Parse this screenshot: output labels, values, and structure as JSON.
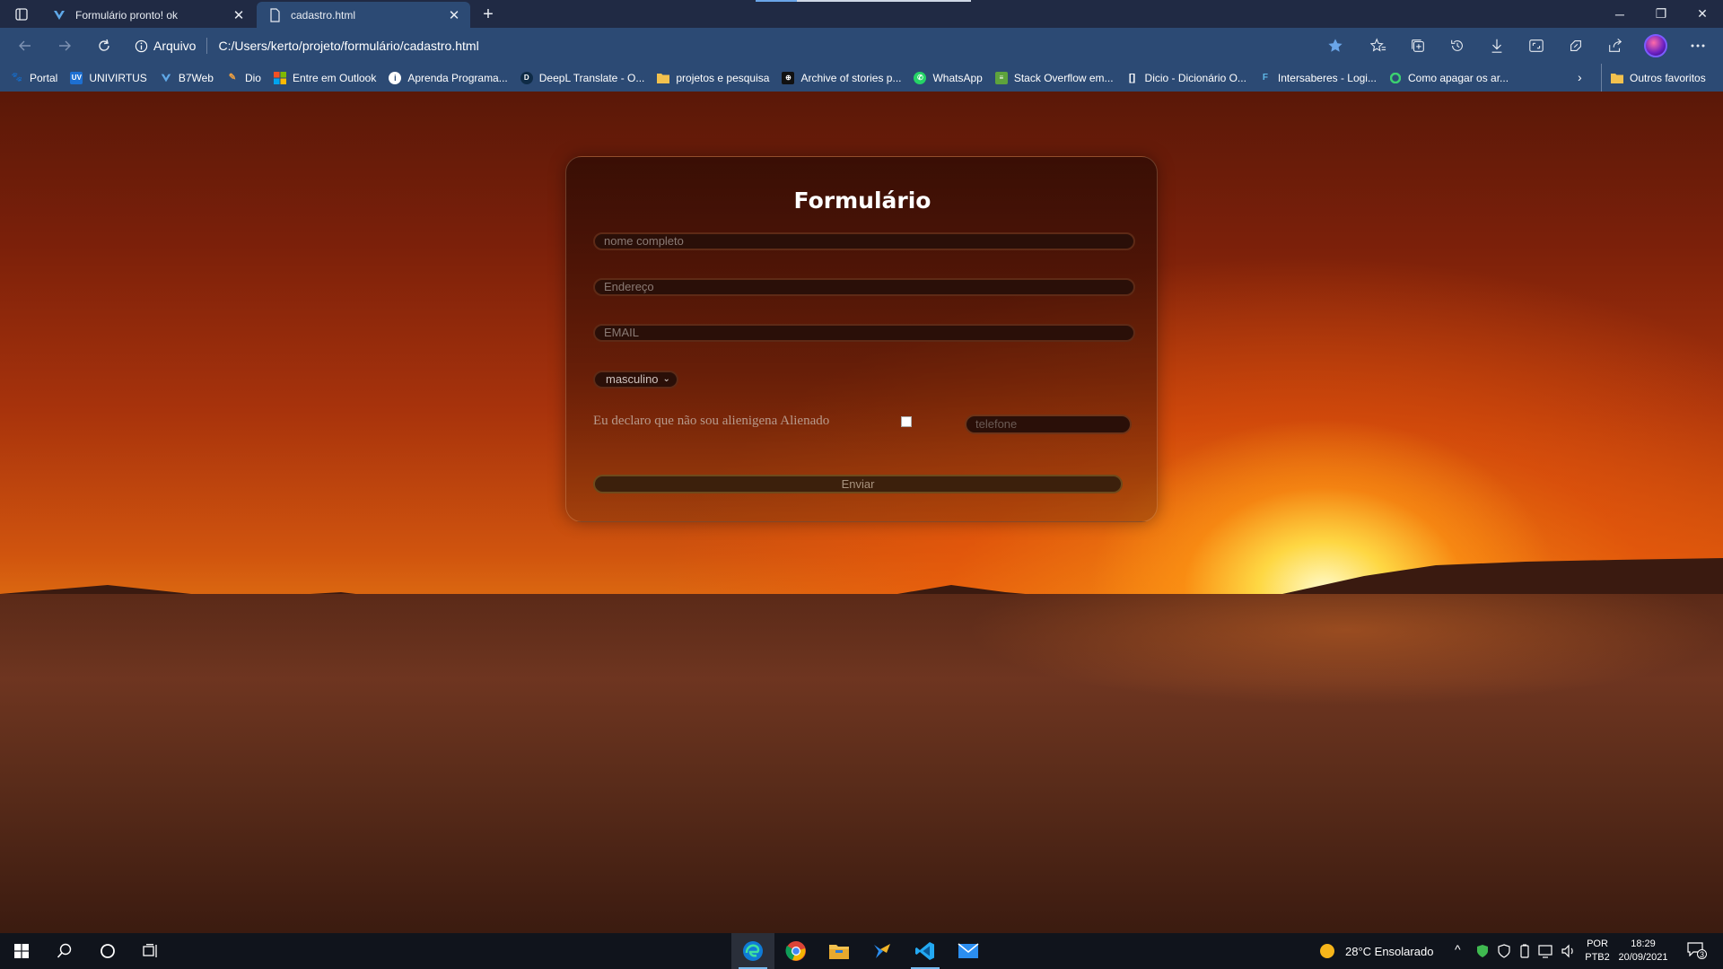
{
  "browser": {
    "tabs": [
      {
        "title": "Formulário pronto! ok",
        "active": false
      },
      {
        "title": "cadastro.html",
        "active": true
      }
    ],
    "address": {
      "site_info_label": "Arquivo",
      "url": "C:/Users/kerto/projeto/formulário/cadastro.html"
    },
    "bookmarks": [
      {
        "label": "Portal",
        "icon": "portal-icon"
      },
      {
        "label": "UNIVIRTUS",
        "icon": "univirtus-icon"
      },
      {
        "label": "B7Web",
        "icon": "b7web-icon"
      },
      {
        "label": "Dio",
        "icon": "dio-icon"
      },
      {
        "label": "Entre em Outlook",
        "icon": "microsoft-icon"
      },
      {
        "label": "Aprenda Programa...",
        "icon": "aprenda-icon"
      },
      {
        "label": "DeepL Translate - O...",
        "icon": "deepl-icon"
      },
      {
        "label": "projetos e pesquisa",
        "icon": "folder-icon"
      },
      {
        "label": "Archive of stories p...",
        "icon": "archive-icon"
      },
      {
        "label": "WhatsApp",
        "icon": "whatsapp-icon"
      },
      {
        "label": "Stack Overflow em...",
        "icon": "stackoverflow-icon"
      },
      {
        "label": "Dicio - Dicionário O...",
        "icon": "dicio-icon"
      },
      {
        "label": "Intersaberes - Logi...",
        "icon": "intersaberes-icon"
      },
      {
        "label": "Como apagar os ar...",
        "icon": "green-circle-icon"
      }
    ],
    "other_favorites": "Outros favoritos"
  },
  "form": {
    "title": "Formulário",
    "name_placeholder": "nome completo",
    "address_placeholder": "Endereço",
    "email_placeholder": "EMAIL",
    "gender_selected": "masculino",
    "declaration": "Eu declaro que não sou alienigena Alienado",
    "phone_placeholder": "telefone",
    "submit_label": "Enviar"
  },
  "taskbar": {
    "weather": "28°C  Ensolarado",
    "language_top": "POR",
    "language_bottom": "PTB2",
    "time": "18:29",
    "date": "20/09/2021",
    "notifications": "3"
  },
  "colors": {
    "tab_bar": "#202a44",
    "toolbar": "#2c4a74",
    "accent": "#76b9ed"
  }
}
